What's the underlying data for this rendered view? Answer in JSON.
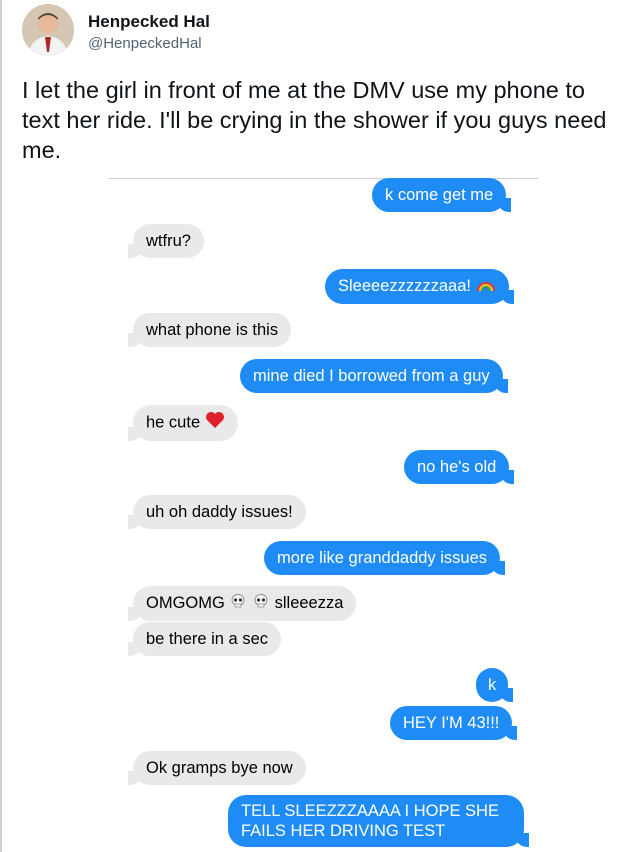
{
  "tweet": {
    "display_name": "Henpecked Hal",
    "handle": "@HenpeckedHal",
    "text": "I let the girl in front of me at the DMV use my phone to text her ride. I'll be crying in the shower if you guys need me."
  },
  "messages": [
    {
      "dir": "out",
      "text": "k come get me"
    },
    {
      "dir": "in",
      "text": "wtfru?"
    },
    {
      "dir": "out",
      "text": "Sleeeezzzzzzaaa!",
      "icon": "rainbow-icon"
    },
    {
      "dir": "in",
      "text": "what phone is this"
    },
    {
      "dir": "out",
      "text": "mine died I borrowed from a guy"
    },
    {
      "dir": "in",
      "text": "he cute",
      "icon": "red-heart-icon"
    },
    {
      "dir": "out",
      "text": "no he's old"
    },
    {
      "dir": "in",
      "text": "uh oh daddy issues!"
    },
    {
      "dir": "out",
      "text": "more like granddaddy issues"
    },
    {
      "dir": "in",
      "text_a": "OMGOMG",
      "text_b": "slleeezza",
      "icon": "skull-icon"
    },
    {
      "dir": "in",
      "text": "be there in a sec"
    },
    {
      "dir": "out",
      "text": "k"
    },
    {
      "dir": "out",
      "text": "HEY I'M 43!!!"
    },
    {
      "dir": "in",
      "text": "Ok gramps bye now"
    },
    {
      "dir": "out",
      "text": "TELL SLEEZZZAAAA I HOPE SHE FAILS HER DRIVING TEST"
    }
  ],
  "colors": {
    "incoming_bubble": "#e9e9eb",
    "outgoing_bubble": "#1f8bf5",
    "handle": "#536471"
  }
}
